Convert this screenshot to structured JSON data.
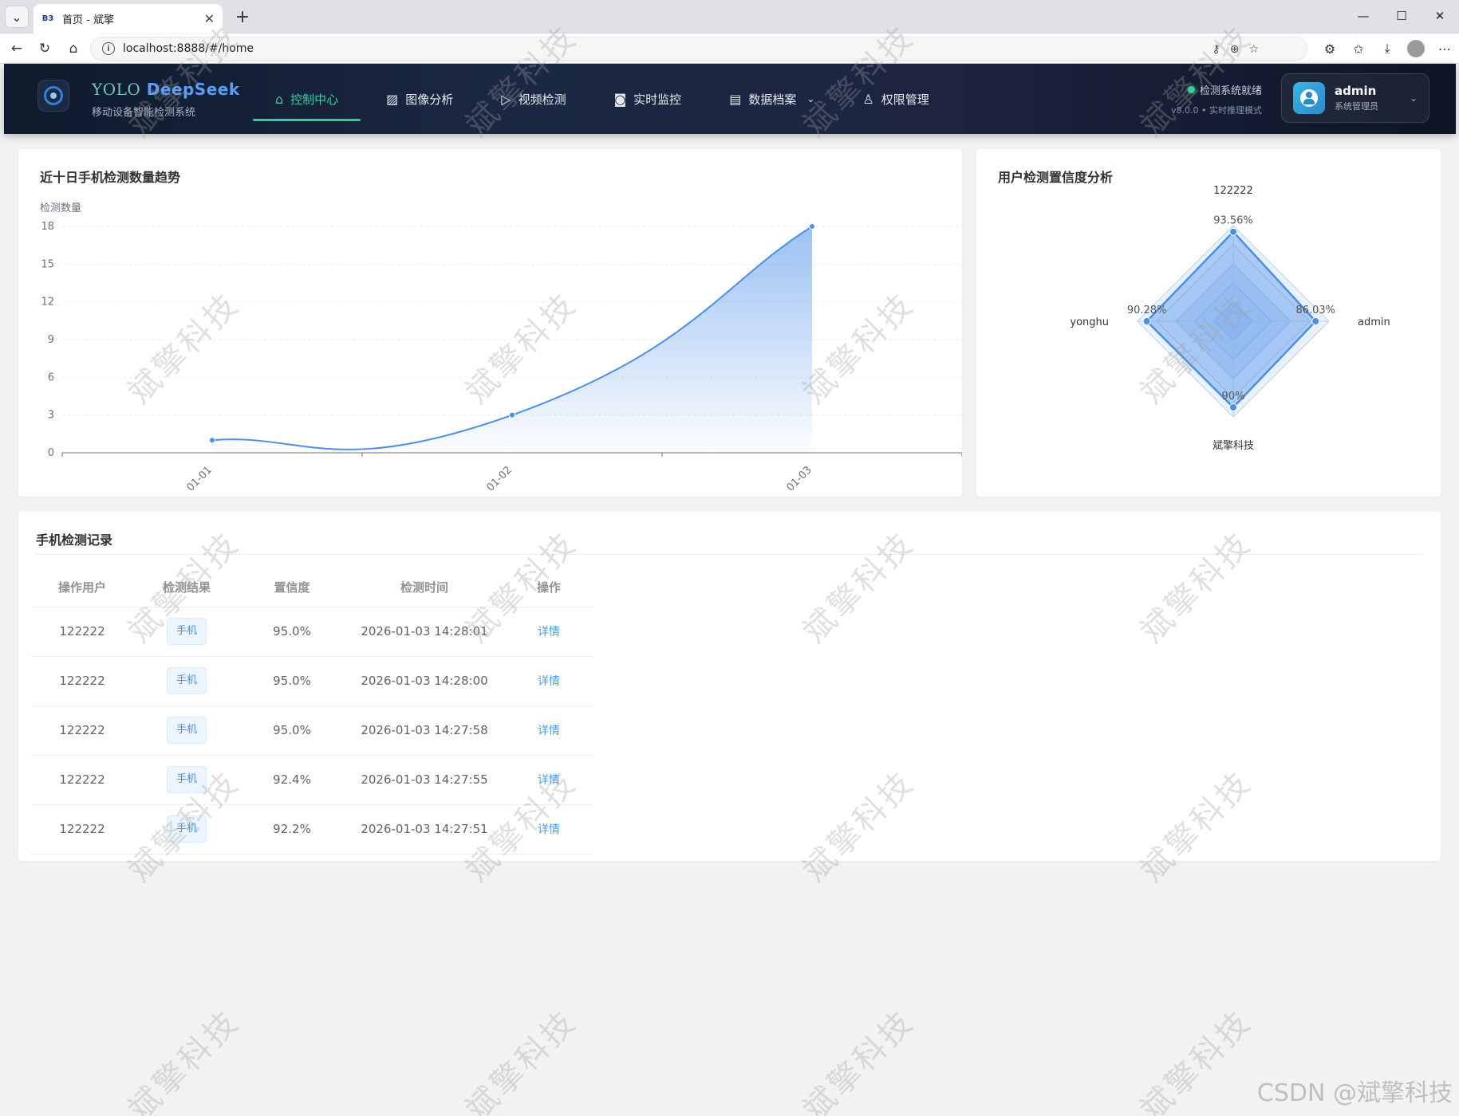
{
  "browser": {
    "tab_title": "首页 - 斌擎",
    "favicon_text": "B3",
    "url": "localhost:8888/#/home"
  },
  "header": {
    "brand_yolo": "YOLO",
    "brand_main": "DeepSeek",
    "brand_sub": "移动设备智能检测系统",
    "nav": [
      {
        "label": "控制中心",
        "icon": "home-icon",
        "active": true
      },
      {
        "label": "图像分析",
        "icon": "image-icon"
      },
      {
        "label": "视频检测",
        "icon": "play-circle-icon"
      },
      {
        "label": "实时监控",
        "icon": "camera-icon"
      },
      {
        "label": "数据档案",
        "icon": "document-icon",
        "has_dropdown": true
      },
      {
        "label": "权限管理",
        "icon": "user-icon"
      }
    ],
    "status_text": "检测系统就绪",
    "status_sub": "v8.0.0 • 实时推理模式",
    "status_color": "#2fd39a",
    "user_name": "admin",
    "user_role": "系统管理员"
  },
  "trend": {
    "title": "近十日手机检测数量趋势",
    "ylabel": "检测数量",
    "accent": "#4a8ee8"
  },
  "radar": {
    "title": "用户检测置信度分析"
  },
  "chart_data": [
    {
      "type": "line",
      "title": "近十日手机检测数量趋势",
      "ylabel": "检测数量",
      "x": [
        "01-01",
        "01-02",
        "01-03"
      ],
      "series": [
        {
          "values": [
            1,
            3,
            18
          ]
        }
      ],
      "ylim": [
        0,
        18
      ],
      "yticks": [
        0,
        3,
        6,
        9,
        12,
        15,
        18
      ],
      "area_fill": true,
      "smooth": true,
      "grid": true
    },
    {
      "type": "radar",
      "title": "用户检测置信度分析",
      "indicators": [
        "122222",
        "admin",
        "斌擎科技",
        "yonghu"
      ],
      "values": [
        93.56,
        86.03,
        90,
        90.28
      ],
      "value_labels": [
        "93.56%",
        "86.03%",
        "90%",
        "90.28%"
      ]
    }
  ],
  "records": {
    "title": "手机检测记录",
    "columns": [
      "操作用户",
      "检测结果",
      "置信度",
      "检测时间",
      "操作"
    ],
    "rows": [
      {
        "user": "122222",
        "result": "手机",
        "confidence": "95.0%",
        "time": "2026-01-03 14:28:01",
        "action": "详情"
      },
      {
        "user": "122222",
        "result": "手机",
        "confidence": "95.0%",
        "time": "2026-01-03 14:28:00",
        "action": "详情"
      },
      {
        "user": "122222",
        "result": "手机",
        "confidence": "95.0%",
        "time": "2026-01-03 14:27:58",
        "action": "详情"
      },
      {
        "user": "122222",
        "result": "手机",
        "confidence": "92.4%",
        "time": "2026-01-03 14:27:55",
        "action": "详情"
      },
      {
        "user": "122222",
        "result": "手机",
        "confidence": "92.2%",
        "time": "2026-01-03 14:27:51",
        "action": "详情"
      }
    ]
  },
  "watermark": {
    "text": "斌擎科技",
    "footer": "CSDN @斌擎科技"
  }
}
